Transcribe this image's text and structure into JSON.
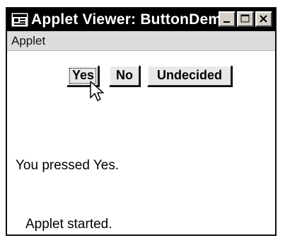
{
  "window": {
    "title": "Applet Viewer: ButtonDemo",
    "controls": {
      "minimize_icon": "minimize-icon",
      "maximize_icon": "maximize-icon",
      "close_icon": "close-icon"
    }
  },
  "menu": {
    "items": [
      {
        "label": "Applet"
      }
    ]
  },
  "applet": {
    "buttons": [
      {
        "label": "Yes",
        "focused": true
      },
      {
        "label": "No",
        "focused": false
      },
      {
        "label": "Undecided",
        "focused": false
      }
    ],
    "message": "You pressed Yes."
  },
  "status": {
    "text": "Applet started."
  },
  "colors": {
    "titlebar_bg": "#000000",
    "titlebar_text": "#ffffff",
    "menubar_bg": "#dcdcdc",
    "button_face": "#e8e8e8",
    "content_bg": "#ffffff"
  }
}
